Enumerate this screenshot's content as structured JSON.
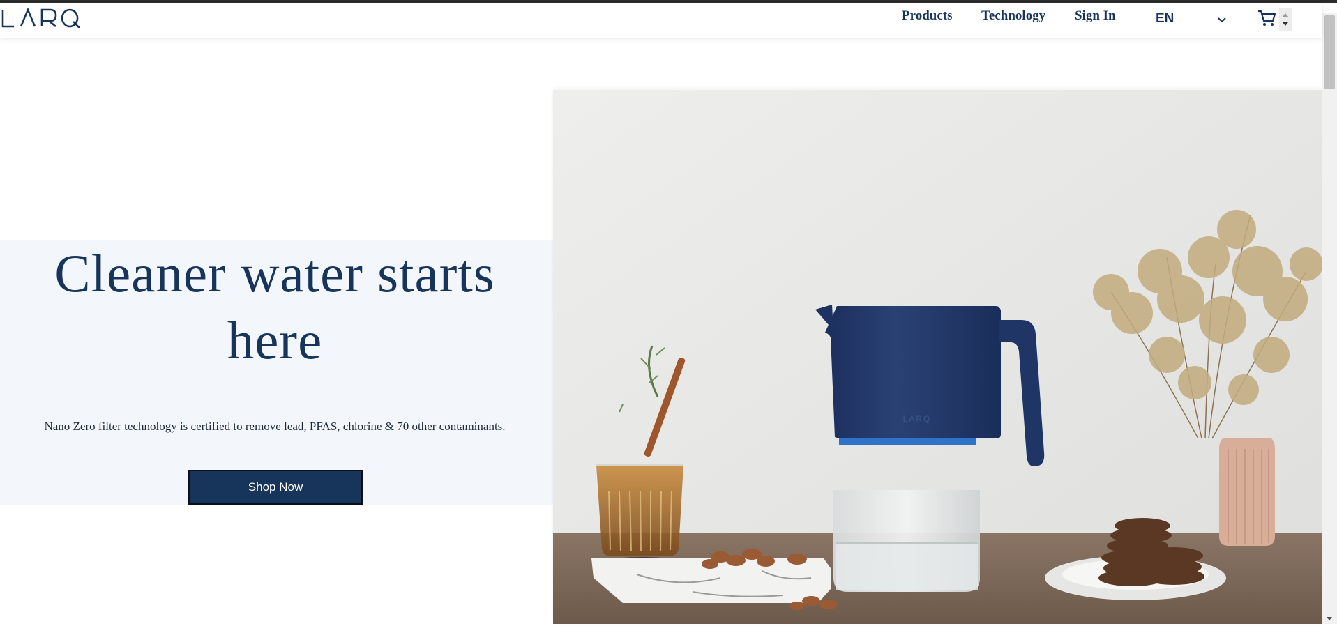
{
  "brand": {
    "logo_text": "LARQ"
  },
  "nav": {
    "products": "Products",
    "technology": "Technology",
    "sign_in": "Sign In"
  },
  "language": {
    "selected": "EN"
  },
  "hero": {
    "headline": "Cleaner water starts here",
    "subtext": "Nano Zero filter technology is certified to remove lead, PFAS, chlorine & 70 other contaminants.",
    "cta_label": "Shop Now",
    "pitcher_logo": "LARQ"
  },
  "icons": {
    "cart": "cart-icon",
    "chevron": "chevron-down-icon",
    "spinner_up": "spinner-up-icon",
    "spinner_down": "spinner-down-icon"
  },
  "colors": {
    "brand_navy": "#17355b",
    "hero_panel": "#f3f7fb",
    "pitcher_blue": "#22396b"
  }
}
